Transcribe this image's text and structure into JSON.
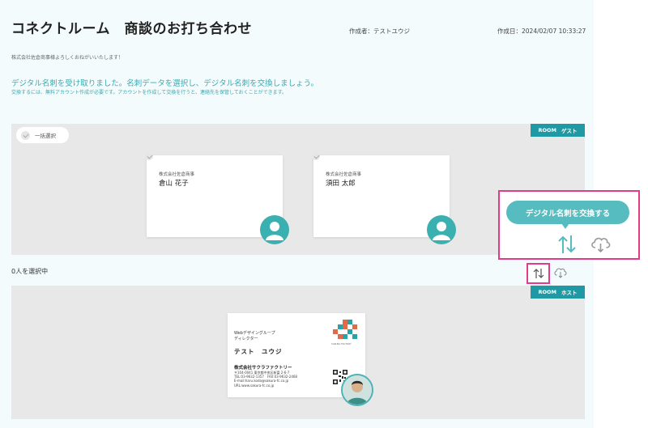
{
  "header": {
    "title": "コネクトルーム　商談のお打ち合わせ",
    "creator": "作成者：テストユウジ",
    "created_at": "作成日：2024/02/07 10:33:27"
  },
  "greeting": "株式会社佐倉商事様よろしくおねがいいたします！",
  "info": {
    "main": "デジタル名刺を受け取りました。名刺データを選択し、デジタル名刺を交換しましょう。",
    "sub": "交換するには、無料アカウント作成が必要です。アカウントを作成して交換を行うと、連絡先を保管しておくことができます。"
  },
  "guest_room": {
    "badge_room": "ROOM",
    "badge_role": "ゲスト",
    "select_all_label": "一括選択",
    "cards": [
      {
        "company": "株式会社佐倉商事",
        "name": "倉山 花子"
      },
      {
        "company": "株式会社佐倉商事",
        "name": "須田 太郎"
      }
    ]
  },
  "selection": {
    "count_text": "0人を選択中"
  },
  "exchange_callout": {
    "button_label": "デジタル名刺を交換する"
  },
  "host_room": {
    "badge_room": "ROOM",
    "badge_role": "ホスト",
    "card": {
      "dept_line1": "Webデザイングループ",
      "dept_line2": "ディレクター",
      "name": "テスト　ユウジ",
      "company": "株式会社サクラファクトリー",
      "address": "〒104-0041 東京都中央区新富 2-6-7",
      "tel_fax": "TEL:03-9632-1357　FAX:03-9632-2468",
      "email": "E-mail:haru.koda@sakura-fc.co.jp",
      "url": "URL:www.sakura-fc.co.jp",
      "logo_text": "SAKURA FACTORY"
    }
  },
  "colors": {
    "teal": "#1f9aa5",
    "accent_teal": "#57bcbf",
    "highlight_pink": "#e23b8a",
    "area_gray": "#e8e8e8",
    "page_bg": "#f3fbfc"
  }
}
